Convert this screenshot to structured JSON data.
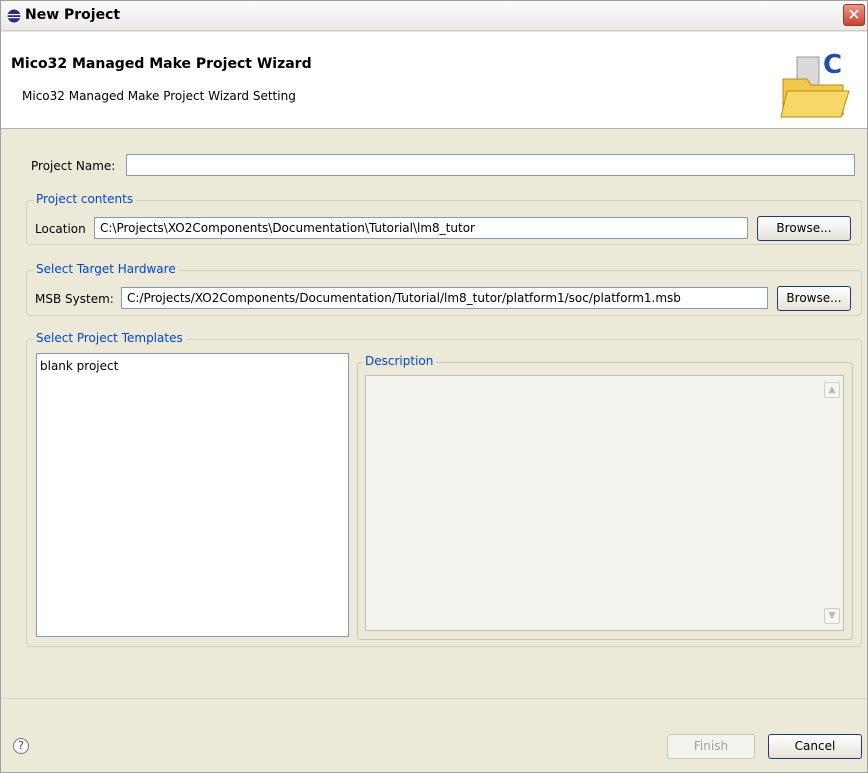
{
  "window": {
    "title": "New Project",
    "close_glyph": "✕"
  },
  "header": {
    "title": "Mico32 Managed Make Project Wizard",
    "subtitle": "Mico32 Managed Make Project Wizard Setting",
    "icon": "folder-c-icon"
  },
  "project_name": {
    "label": "Project Name:",
    "value": ""
  },
  "project_contents": {
    "legend": "Project contents",
    "location_label": "Location",
    "location_value": "C:\\Projects\\XO2Components\\Documentation\\Tutorial\\lm8_tutor",
    "browse_label": "Browse..."
  },
  "target_hardware": {
    "legend": "Select Target Hardware",
    "msb_label": "MSB System:",
    "msb_value": "C:/Projects/XO2Components/Documentation/Tutorial/lm8_tutor/platform1/soc/platform1.msb",
    "browse_label": "Browse..."
  },
  "templates": {
    "legend": "Select Project Templates",
    "items": [
      "blank project"
    ],
    "description_legend": "Description",
    "description_text": ""
  },
  "footer": {
    "help_glyph": "?",
    "finish_label": "Finish",
    "cancel_label": "Cancel"
  },
  "colors": {
    "group_legend": "#0046d5",
    "dialog_bg": "#ece9d8",
    "close_button": "#c8452f"
  }
}
